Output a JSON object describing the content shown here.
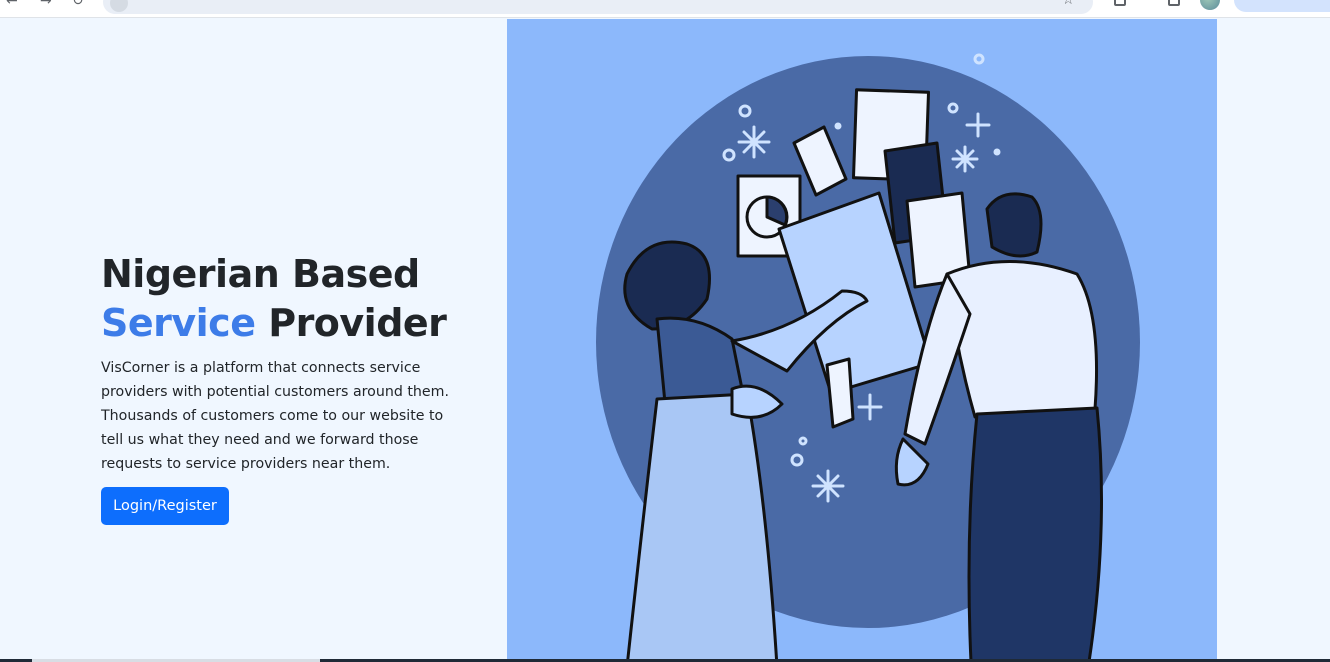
{
  "hero": {
    "title_line1": "Nigerian Based",
    "title_accent": "Service",
    "title_rest": " Provider",
    "description": "VisCorner is a platform that connects service providers with potential customers around them. Thousands of customers come to our website to tell us what they need and we forward those requests to service providers near them.",
    "cta_label": "Login/Register"
  },
  "colors": {
    "page_background": "#f0f7ff",
    "accent_text": "#3d7ce8",
    "button": "#0d6efd",
    "illustration_background": "#8cb8fb",
    "illustration_circle": "#4a6aa6"
  },
  "icons": {
    "browser": [
      "back-icon",
      "reload-icon",
      "bookmark-star-icon",
      "extension-icon",
      "profile-avatar-icon"
    ],
    "illustration": "two-people-collaborating-illustration"
  }
}
